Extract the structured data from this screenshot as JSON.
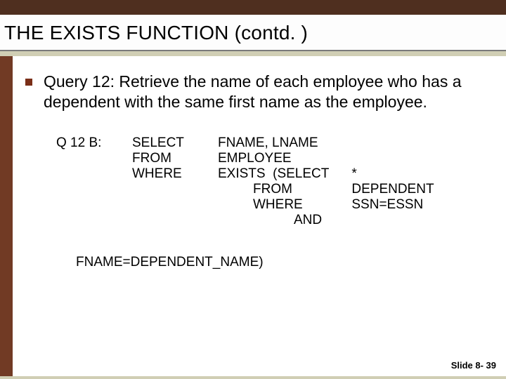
{
  "title": "THE EXISTS FUNCTION (contd. )",
  "body": {
    "text": "Query 12: Retrieve the name of each employee who has a dependent with the same first name as the employee."
  },
  "query": {
    "label": "Q 12 B:",
    "col1": [
      "SELECT",
      "FROM",
      "WHERE"
    ],
    "col2": [
      "FNAME, LNAME",
      "EMPLOYEE",
      "EXISTS  (SELECT",
      "FROM",
      "WHERE",
      "AND"
    ],
    "col3": [
      "*",
      "DEPENDENT",
      "SSN=ESSN"
    ],
    "closing": "FNAME=DEPENDENT_NAME)"
  },
  "footer": "Slide 8- 39"
}
